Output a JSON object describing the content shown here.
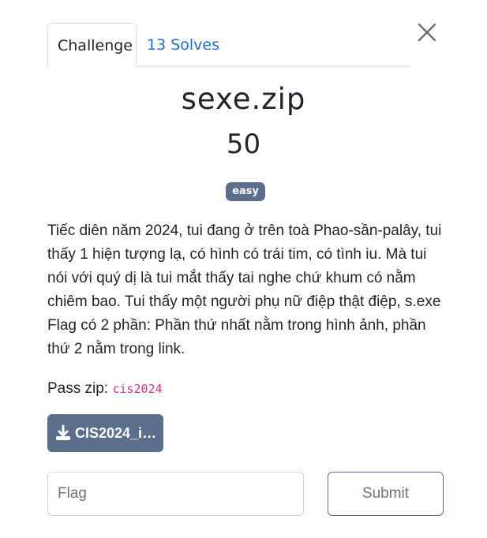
{
  "tabs": [
    {
      "label": "Challenge",
      "active": true
    },
    {
      "label": "13 Solves",
      "active": false
    }
  ],
  "challenge": {
    "name": "sexe.zip",
    "value": "50",
    "tag": "easy",
    "description": "Tiếc diên năm 2024, tui đang ở trên toà Phao-sần-palây, tui thấy 1 hiện tượng lạ, có hình có trái tim, có tình iu. Mà tui nói với quý dị là tui mắt thấy tai nghe chứ khum có nằm chiêm bao. Tui thấy một người phụ nữ điệp thật điệp, s.exe Flag có 2 phần: Phần thứ nhất nằm trong hình ảnh, phần thứ 2 nằm trong link.",
    "pass_label": "Pass zip: ",
    "pass_value": "cis2024"
  },
  "download": {
    "label": "CIS2024_is…",
    "icon": "download-icon"
  },
  "form": {
    "flag_placeholder": "Flag",
    "submit_label": "Submit"
  },
  "close_icon": "close-icon",
  "colors": {
    "accent": "#5b6e8c",
    "link": "#1e6fd9",
    "code": "#d63384"
  }
}
